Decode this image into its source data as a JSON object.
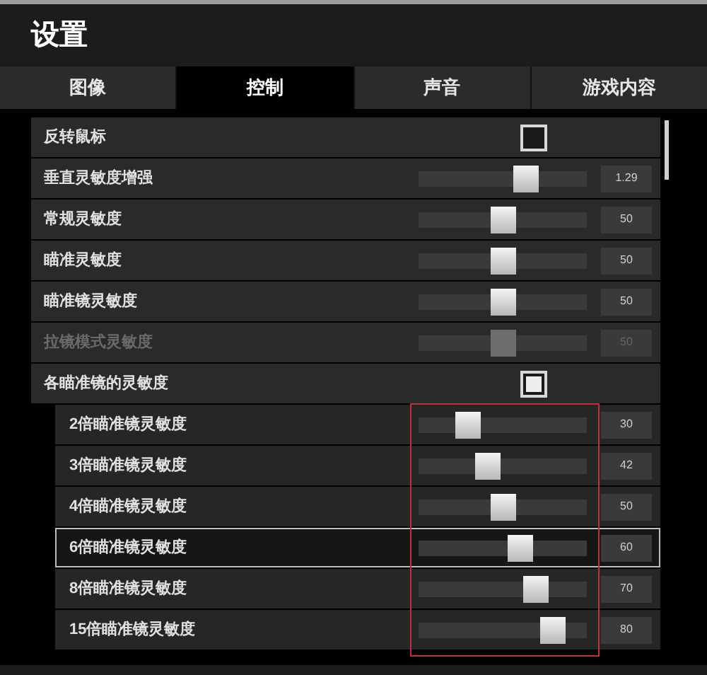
{
  "window": {
    "title": "设置"
  },
  "tabs": [
    {
      "label": "图像",
      "selected": false
    },
    {
      "label": "控制",
      "selected": true
    },
    {
      "label": "声音",
      "selected": false
    },
    {
      "label": "游戏内容",
      "selected": false
    }
  ],
  "settings": [
    {
      "kind": "checkbox",
      "label": "反转鼠标",
      "checked": false,
      "disabled": false,
      "selected": false
    },
    {
      "kind": "slider",
      "label": "垂直灵敏度增强",
      "level": 0.66,
      "reading": "1.29",
      "disabled": false,
      "selected": false
    },
    {
      "kind": "slider",
      "label": "常规灵敏度",
      "level": 0.5,
      "reading": "50",
      "disabled": false,
      "selected": false
    },
    {
      "kind": "slider",
      "label": "瞄准灵敏度",
      "level": 0.5,
      "reading": "50",
      "disabled": false,
      "selected": false
    },
    {
      "kind": "slider",
      "label": "瞄准镜灵敏度",
      "level": 0.5,
      "reading": "50",
      "disabled": false,
      "selected": false
    },
    {
      "kind": "slider",
      "label": "拉镜模式灵敏度",
      "level": 0.5,
      "reading": "50",
      "disabled": true,
      "selected": false
    },
    {
      "kind": "checkbox",
      "label": "各瞄准镜的灵敏度",
      "checked": true,
      "disabled": false,
      "selected": false,
      "children": [
        {
          "kind": "slider",
          "label": "2倍瞄准镜灵敏度",
          "level": 0.26,
          "reading": "30",
          "disabled": false,
          "selected": false
        },
        {
          "kind": "slider",
          "label": "3倍瞄准镜灵敏度",
          "level": 0.4,
          "reading": "42",
          "disabled": false,
          "selected": false
        },
        {
          "kind": "slider",
          "label": "4倍瞄准镜灵敏度",
          "level": 0.5,
          "reading": "50",
          "disabled": false,
          "selected": false
        },
        {
          "kind": "slider",
          "label": "6倍瞄准镜灵敏度",
          "level": 0.62,
          "reading": "60",
          "disabled": false,
          "selected": true
        },
        {
          "kind": "slider",
          "label": "8倍瞄准镜灵敏度",
          "level": 0.73,
          "reading": "70",
          "disabled": false,
          "selected": false
        },
        {
          "kind": "slider",
          "label": "15倍瞄准镜灵敏度",
          "level": 0.85,
          "reading": "80",
          "disabled": false,
          "selected": false
        }
      ]
    }
  ]
}
